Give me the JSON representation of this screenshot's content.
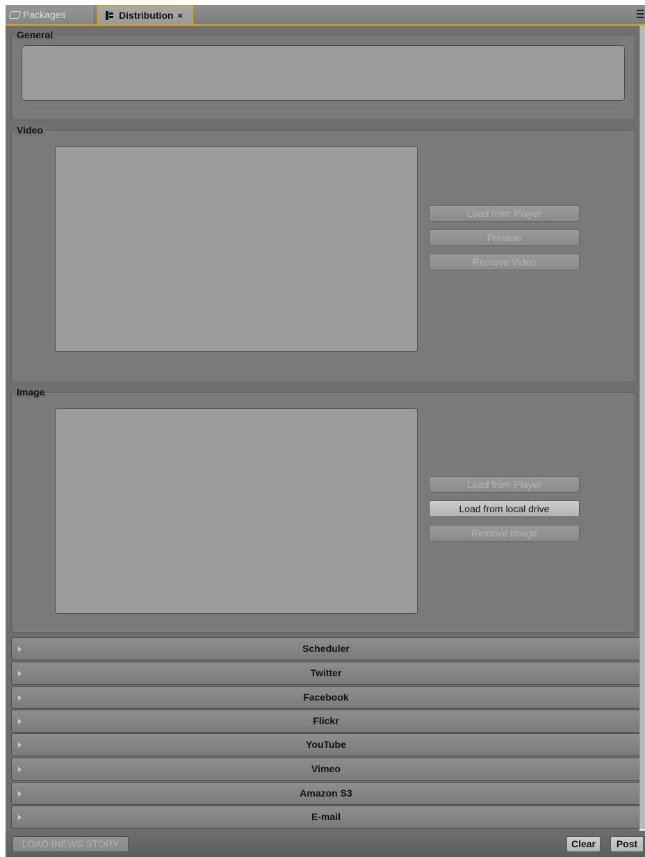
{
  "tabs": [
    {
      "label": "Packages",
      "icon": "packages-icon",
      "active": false
    },
    {
      "label": "Distribution",
      "icon": "distribution-icon",
      "active": true,
      "close": "×"
    }
  ],
  "sections": {
    "general": {
      "title": "General"
    },
    "video": {
      "title": "Video",
      "buttons": [
        {
          "label": "Load from Player",
          "enabled": false
        },
        {
          "label": "Preview",
          "enabled": false
        },
        {
          "label": "Remove Video",
          "enabled": false
        }
      ]
    },
    "image": {
      "title": "Image",
      "buttons": [
        {
          "label": "Load from Player",
          "enabled": false
        },
        {
          "label": "Load from local drive",
          "enabled": true
        },
        {
          "label": "Remove Image",
          "enabled": false
        }
      ]
    }
  },
  "collapsible": [
    {
      "label": "Scheduler"
    },
    {
      "label": "Twitter"
    },
    {
      "label": "Facebook"
    },
    {
      "label": "Flickr"
    },
    {
      "label": "YouTube"
    },
    {
      "label": "Vimeo"
    },
    {
      "label": "Amazon S3"
    },
    {
      "label": "E-mail"
    }
  ],
  "footer": {
    "load_inews": "LOAD INEWS STORY",
    "clear": "Clear",
    "post": "Post"
  },
  "colors": {
    "accent": "#d8a51e",
    "panel": "#6f6f6f",
    "group": "#7a7a7a"
  }
}
